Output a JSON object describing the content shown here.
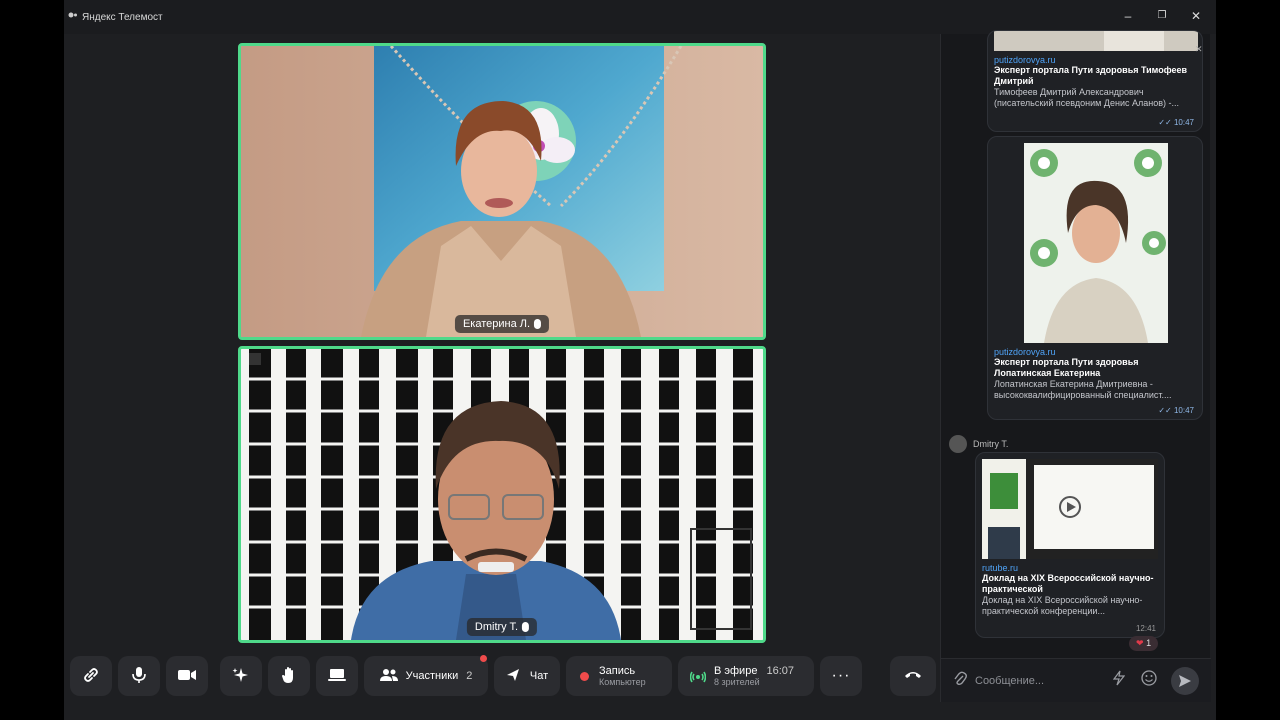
{
  "window": {
    "title": "Яндекс Телемост",
    "minimize": "–",
    "maximize": "❐",
    "close": "✕"
  },
  "participants": [
    {
      "name": "Екатерина Л."
    },
    {
      "name": "Dmitry T."
    }
  ],
  "toolbar": {
    "participants_label": "Участники",
    "participants_count": "2",
    "chat_label": "Чат",
    "record_label": "Запись",
    "record_sub": "Компьютер",
    "live_label": "В эфире",
    "live_time": "16:07",
    "live_viewers": "8 зрителей",
    "more": "···"
  },
  "chat": {
    "messages": [
      {
        "domain": "putizdorovya.ru",
        "head": "Эксперт портала Пути здоровья Тимофеев Дмитрий",
        "desc": "Тимофеев Дмитрий Александрович (писательский псевдоним Денис Аланов) -...",
        "time": "10:47"
      },
      {
        "domain": "putizdorovya.ru",
        "head": "Эксперт портала Пути здоровья Лопатинская Екатерина",
        "desc": "Лопатинская Екатерина Дмитриевна - высококвалифицированный специалист....",
        "time": "10:47"
      },
      {
        "sender": "Dmitry T.",
        "domain": "rutube.ru",
        "head": "Доклад на XIX Всероссийской научно-практической",
        "desc": "Доклад на XIX Всероссийской научно-практической конференции...",
        "time": "12:41",
        "reaction": "1"
      }
    ],
    "input_placeholder": "Сообщение...",
    "close": "✕"
  },
  "colors": {
    "speaker_border": "#4fd98a",
    "link": "#4fa3f7",
    "hangup": "#2b2c30",
    "record_dot": "#ef4b4b",
    "live_icon": "#4fd98a"
  }
}
